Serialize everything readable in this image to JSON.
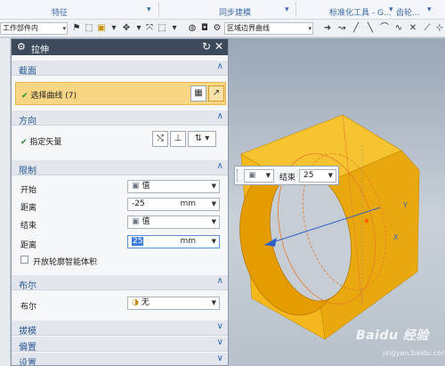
{
  "ribbon": {
    "group_feature": "特征",
    "group_sync": "同步建模",
    "group_std": "标准化工具 - G...",
    "group_gear": "齿轮...",
    "more_arrow": "▾"
  },
  "toolbar": {
    "scope_value": "工作部件内",
    "boundary_value": "区域边界曲线"
  },
  "dialog": {
    "title": "拉伸",
    "section": {
      "label": "截面",
      "select_curve": "选择曲线 (7)"
    },
    "direction": {
      "label": "方向",
      "vector": "指定矢量"
    },
    "limits": {
      "label": "限制",
      "start_label": "开始",
      "start_value": "值",
      "distance1_label": "距离",
      "distance1_value": "-25",
      "distance1_unit": "mm",
      "end_label": "结束",
      "end_value": "值",
      "distance2_label": "距离",
      "distance2_value": "25",
      "distance2_unit": "mm",
      "open_profile": "开放轮廓智能体积"
    },
    "boolean": {
      "label": "布尔",
      "row_label": "布尔",
      "value": "无"
    },
    "draft": {
      "label": "拔模"
    },
    "offset": {
      "label": "偏置"
    },
    "settings": {
      "label": "设置"
    }
  },
  "float_bar": {
    "label": "结束",
    "value": "25"
  },
  "watermark": {
    "brand": "Baidu 经验",
    "sub": "jingyan.baidu.com"
  },
  "colors": {
    "title_bar": "#3c4a5c",
    "selection": "#f8d683",
    "section_text": "#2b5a93",
    "model_fill": "#f2b51c",
    "model_dark": "#d18f00"
  }
}
